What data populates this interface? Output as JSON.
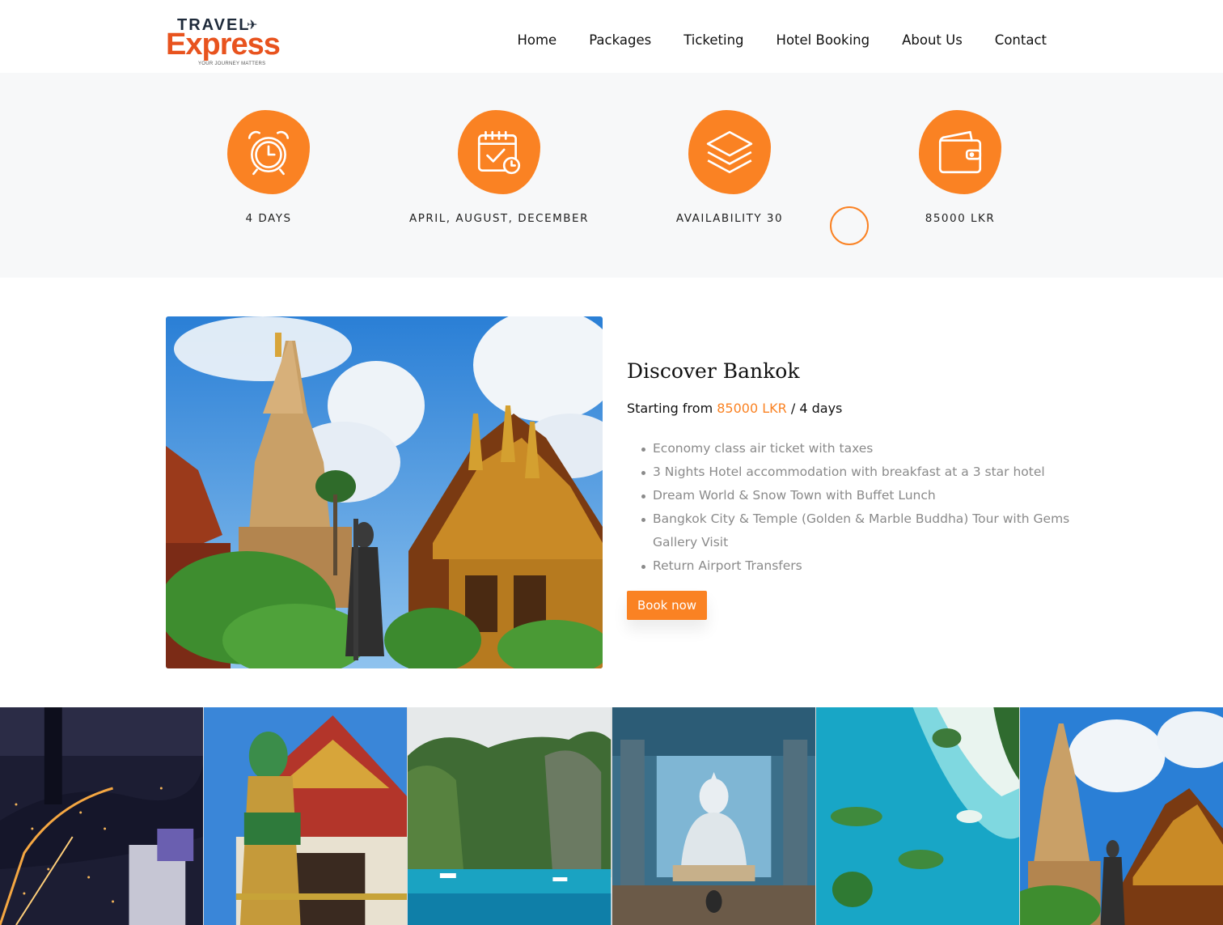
{
  "header": {
    "logo": {
      "top": "TRAVEL",
      "main": "Express",
      "tagline": "YOUR JOURNEY MATTERS"
    },
    "nav": [
      "Home",
      "Packages",
      "Ticketing",
      "Hotel Booking",
      "About Us",
      "Contact"
    ]
  },
  "features": [
    {
      "icon": "alarm-clock-icon",
      "label": "4 DAYS"
    },
    {
      "icon": "calendar-check-icon",
      "label": "APRIL, AUGUST, DECEMBER"
    },
    {
      "icon": "layers-icon",
      "label": "AVAILABILITY 30"
    },
    {
      "icon": "wallet-icon",
      "label": "85000 LKR"
    }
  ],
  "package": {
    "title": "Discover Bankok",
    "price_prefix": "Starting from",
    "price": "85000 LKR",
    "price_suffix": "/ 4 days",
    "inclusions": [
      "Economy class air ticket with taxes",
      "3 Nights Hotel accommodation with breakfast at a 3 star hotel",
      "Dream World & Snow Town with Buffet Lunch",
      "Bangkok City & Temple (Golden & Marble Buddha) Tour with Gems Gallery Visit",
      "Return Airport Transfers"
    ],
    "book_label": "Book now",
    "image": "thai-temple-photo"
  },
  "gallery": [
    "bangkok-night-city-photo",
    "temple-guardian-statue-photo",
    "limestone-cliffs-lagoon-photo",
    "white-buddha-temple-photo",
    "aerial-islands-photo",
    "thai-temple-photo"
  ],
  "colors": {
    "accent": "#fa8223",
    "logo_orange": "#e8531e",
    "band_bg": "#f7f8f9"
  }
}
